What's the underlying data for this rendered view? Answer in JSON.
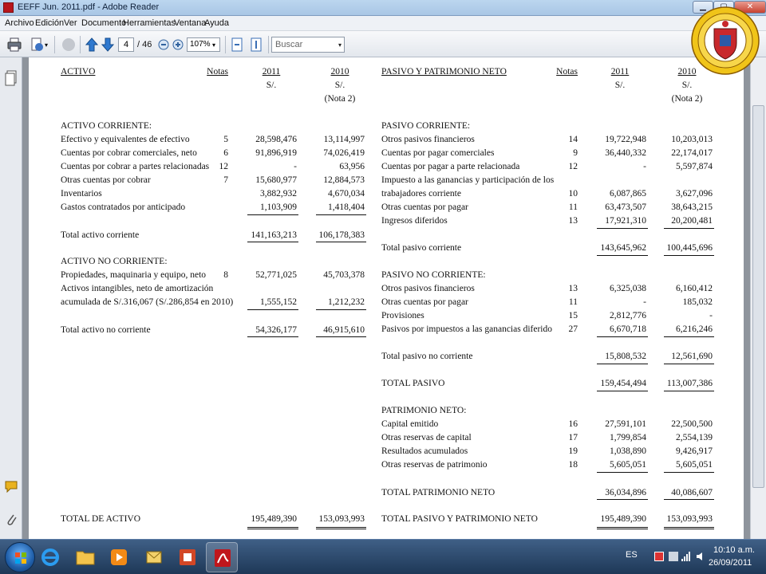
{
  "window": {
    "title": "EEFF Jun. 2011.pdf - Adobe Reader"
  },
  "menu": [
    "Archivo",
    "Edición",
    "Ver",
    "Documento",
    "Herramientas",
    "Ventana",
    "Ayuda"
  ],
  "toolbar": {
    "page_current": "4",
    "page_total": "/ 46",
    "zoom": "107%",
    "search_placeholder": "Buscar"
  },
  "document": {
    "activo": {
      "heading": "ACTIVO",
      "notas_label": "Notas",
      "year1": "2011",
      "year2": "2010",
      "currency1": "S/.",
      "currency2": "S/.",
      "note2": "(Nota 2)",
      "corriente_heading": "ACTIVO CORRIENTE:",
      "corriente_rows": [
        {
          "label": "Efectivo y equivalentes de efectivo",
          "nota": "5",
          "v2011": "28,598,476",
          "v2010": "13,114,997"
        },
        {
          "label": "Cuentas por cobrar comerciales, neto",
          "nota": "6",
          "v2011": "91,896,919",
          "v2010": "74,026,419"
        },
        {
          "label": "Cuentas por cobrar a partes relacionadas",
          "nota": "12",
          "v2011": "-",
          "v2010": "63,956"
        },
        {
          "label": "Otras cuentas por cobrar",
          "nota": "7",
          "v2011": "15,680,977",
          "v2010": "12,884,573"
        },
        {
          "label": "Inventarios",
          "nota": "",
          "v2011": "3,882,932",
          "v2010": "4,670,034"
        },
        {
          "label": "Gastos contratados por anticipado",
          "nota": "",
          "v2011": "1,103,909",
          "v2010": "1,418,404"
        }
      ],
      "total_corriente": {
        "label": "Total activo corriente",
        "v2011": "141,163,213",
        "v2010": "106,178,383"
      },
      "no_corriente_heading": "ACTIVO NO CORRIENTE:",
      "no_corriente_rows": [
        {
          "label": "Propiedades, maquinaria y equipo, neto",
          "nota": "8",
          "v2011": "52,771,025",
          "v2010": "45,703,378"
        },
        {
          "label": "Activos intangibles, neto de amortización",
          "nota": "",
          "v2011": "",
          "v2010": ""
        },
        {
          "label": "acumulada de S/.316,067 (S/.286,854 en 2010)",
          "nota": "",
          "v2011": "1,555,152",
          "v2010": "1,212,232"
        }
      ],
      "total_no_corriente": {
        "label": "Total activo no corriente",
        "v2011": "54,326,177",
        "v2010": "46,915,610"
      },
      "total": {
        "label": "TOTAL DE ACTIVO",
        "v2011": "195,489,390",
        "v2010": "153,093,993"
      }
    },
    "pasivo": {
      "heading": "PASIVO Y PATRIMONIO NETO",
      "notas_label": "Notas",
      "year1": "2011",
      "year2": "2010",
      "currency1": "S/.",
      "currency2": "S/.",
      "note2": "(Nota 2)",
      "corriente_heading": "PASIVO CORRIENTE:",
      "corriente_rows": [
        {
          "label": "Otros pasivos financieros",
          "nota": "14",
          "v2011": "19,722,948",
          "v2010": "10,203,013"
        },
        {
          "label": "Cuentas por pagar comerciales",
          "nota": "9",
          "v2011": "36,440,332",
          "v2010": "22,174,017"
        },
        {
          "label": "Cuentas por pagar a parte relacionada",
          "nota": "12",
          "v2011": "-",
          "v2010": "5,597,874"
        },
        {
          "label": "Impuesto a las ganancias y participación de los",
          "nota": "",
          "v2011": "",
          "v2010": ""
        },
        {
          "label": "trabajadores corriente",
          "nota": "10",
          "v2011": "6,087,865",
          "v2010": "3,627,096"
        },
        {
          "label": "Otras cuentas por pagar",
          "nota": "11",
          "v2011": "63,473,507",
          "v2010": "38,643,215"
        },
        {
          "label": "Ingresos diferidos",
          "nota": "13",
          "v2011": "17,921,310",
          "v2010": "20,200,481"
        }
      ],
      "total_corriente": {
        "label": "Total pasivo corriente",
        "v2011": "143,645,962",
        "v2010": "100,445,696"
      },
      "no_corriente_heading": "PASIVO NO CORRIENTE:",
      "no_corriente_rows": [
        {
          "label": "Otros pasivos financieros",
          "nota": "13",
          "v2011": "6,325,038",
          "v2010": "6,160,412"
        },
        {
          "label": "Otras cuentas por pagar",
          "nota": "11",
          "v2011": "-",
          "v2010": "185,032"
        },
        {
          "label": "Provisiones",
          "nota": "15",
          "v2011": "2,812,776",
          "v2010": "-"
        },
        {
          "label": "Pasivos por impuestos a las ganancias diferido",
          "nota": "27",
          "v2011": "6,670,718",
          "v2010": "6,216,246"
        }
      ],
      "total_no_corriente": {
        "label": "Total pasivo no corriente",
        "v2011": "15,808,532",
        "v2010": "12,561,690"
      },
      "total_pasivo": {
        "label": "TOTAL PASIVO",
        "v2011": "159,454,494",
        "v2010": "113,007,386"
      },
      "patrimonio_heading": "PATRIMONIO NETO:",
      "patrimonio_rows": [
        {
          "label": "Capital emitido",
          "nota": "16",
          "v2011": "27,591,101",
          "v2010": "22,500,500"
        },
        {
          "label": "Otras reservas de capital",
          "nota": "17",
          "v2011": "1,799,854",
          "v2010": "2,554,139"
        },
        {
          "label": "Resultados acumulados",
          "nota": "19",
          "v2011": "1,038,890",
          "v2010": "9,426,917"
        },
        {
          "label": "Otras reservas de patrimonio",
          "nota": "18",
          "v2011": "5,605,051",
          "v2010": "5,605,051"
        }
      ],
      "total_patrimonio": {
        "label": "TOTAL PATRIMONIO NETO",
        "v2011": "36,034,896",
        "v2010": "40,086,607"
      },
      "total": {
        "label": "TOTAL PASIVO Y PATRIMONIO NETO",
        "v2011": "195,489,390",
        "v2010": "153,093,993"
      }
    }
  },
  "taskbar": {
    "language": "ES",
    "time": "10:10 a.m.",
    "date": "26/09/2011"
  },
  "colors": {
    "titlebar": "#bcd6ef",
    "taskbar": "#2a4a70",
    "acrobat_red": "#c0161c"
  }
}
